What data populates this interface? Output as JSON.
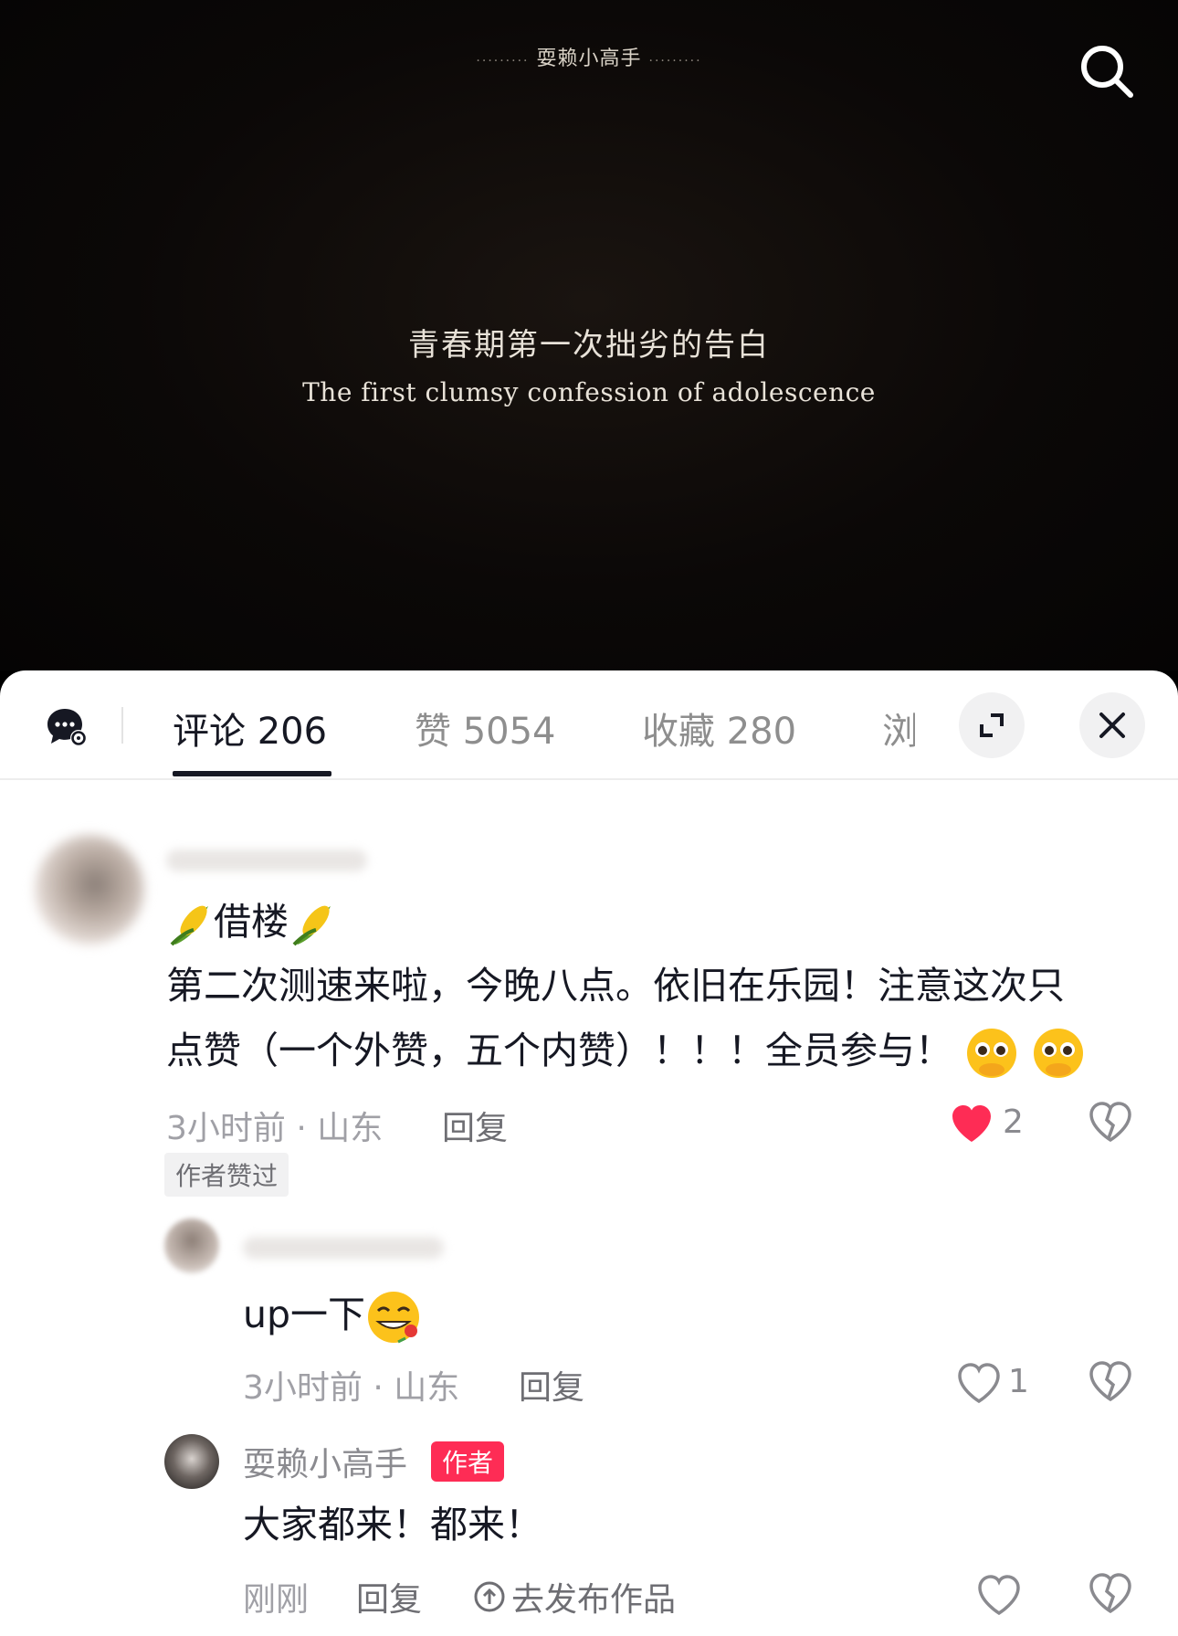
{
  "video": {
    "brand": "耍赖小高手",
    "brand_dots": "·········",
    "caption_cn": "青春期第一次拙劣的告白",
    "caption_en": "The first clumsy confession of adolescence"
  },
  "tabs": [
    {
      "label": "评论 206",
      "active": true
    },
    {
      "label": "赞 5054",
      "active": false
    },
    {
      "label": "收藏 280",
      "active": false
    },
    {
      "label": "浏览",
      "active": false
    }
  ],
  "comments": {
    "c1": {
      "pinned": "借楼",
      "text_line1": "第二次测速来啦，今晚八点。依旧在乐园！注意这次只",
      "text_line2": "点赞（一个外赞，五个内赞）！！！全员参与！",
      "time_loc": "3小时前 · 山东",
      "reply": "回复",
      "likes": "2",
      "liked": true,
      "badge": "作者赞过"
    },
    "c2": {
      "text": "up一下",
      "time_loc": "3小时前 · 山东",
      "reply": "回复",
      "likes": "1"
    },
    "c3": {
      "username": "耍赖小高手",
      "author_tag": "作者",
      "text": "大家都来！都来！",
      "time": "刚刚",
      "reply": "回复",
      "publish": "去发布作品"
    }
  },
  "colors": {
    "accent": "#fe2c55",
    "text": "#161823",
    "muted": "#a0a0a6"
  }
}
